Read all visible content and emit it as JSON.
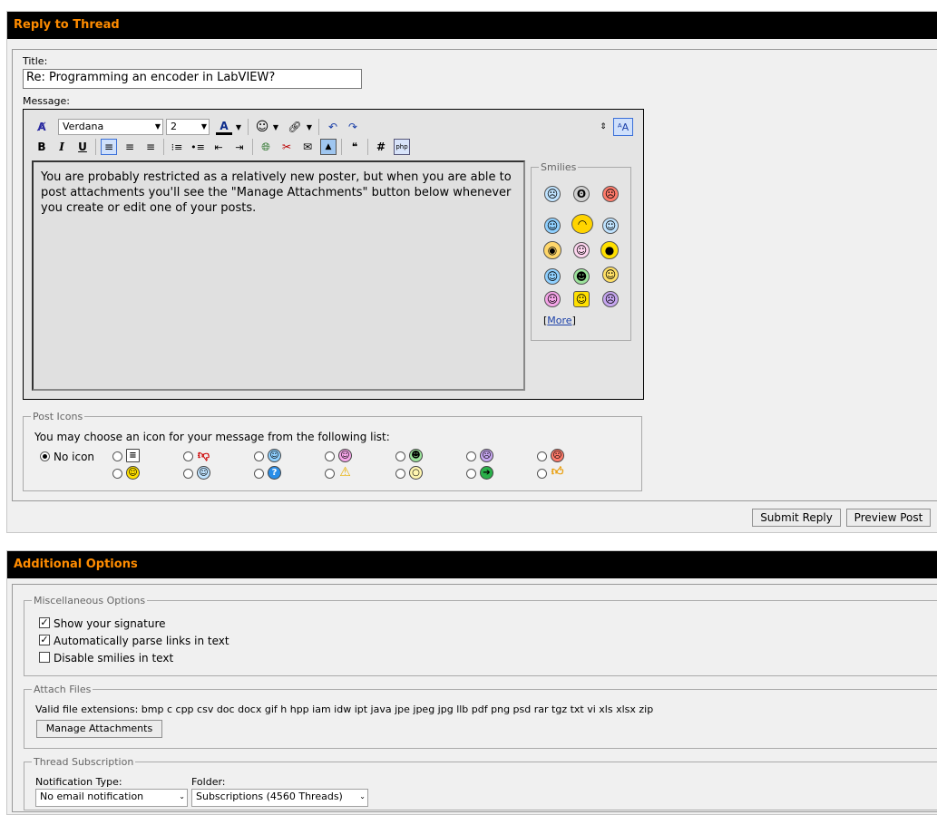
{
  "reply": {
    "header": "Reply to Thread",
    "title_label": "Title:",
    "title_value": "Re: Programming an encoder in LabVIEW?",
    "message_label": "Message:",
    "font_name": "Verdana",
    "font_size": "2",
    "message_text": "You are probably restricted as a relatively new poster, but when you are able to post attachments you'll see the \"Manage Attachments\" button below whenever you create or edit one of your posts.",
    "smilies_legend": "Smilies",
    "more_link": "More",
    "post_icons_legend": "Post Icons",
    "post_icons_intro": "You may choose an icon for your message from the following list:",
    "no_icon_label": "No icon",
    "submit_label": "Submit Reply",
    "preview_label": "Preview Post"
  },
  "options": {
    "header": "Additional Options",
    "misc_legend": "Miscellaneous Options",
    "checks": [
      {
        "label": "Show your signature",
        "checked": true
      },
      {
        "label": "Automatically parse links in text",
        "checked": true
      },
      {
        "label": "Disable smilies in text",
        "checked": false
      }
    ],
    "attach_legend": "Attach Files",
    "valid_ext": "Valid file extensions: bmp c cpp csv doc docx gif h hpp iam idw ipt java jpe jpeg jpg llb pdf png psd rar tgz txt vi xls xlsx zip",
    "manage_label": "Manage Attachments",
    "subscription_legend": "Thread Subscription",
    "notification_label": "Notification Type:",
    "notification_value": "No email notification",
    "folder_label": "Folder:",
    "folder_value": "Subscriptions (4560 Threads)"
  },
  "colors": {
    "header_bg": "#000000",
    "header_text": "#ff8c00",
    "panel_bg": "#f0f0f0"
  }
}
